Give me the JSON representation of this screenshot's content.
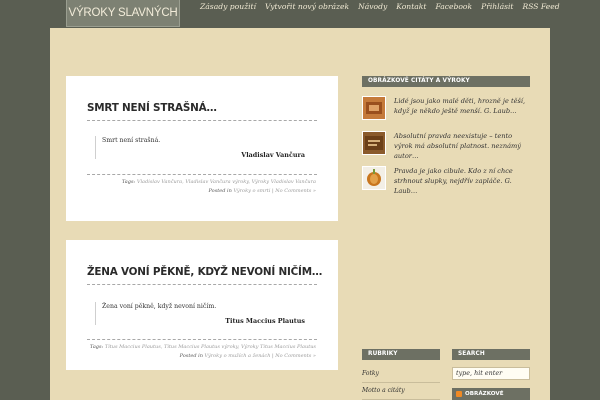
{
  "site": {
    "logo": "VÝROKY SLAVNÝCH"
  },
  "nav": [
    "Zásady použití",
    "Vytvořit nový obrázek",
    "Návody",
    "Kontakt",
    "Facebook",
    "Přihlásit",
    "RSS Feed"
  ],
  "posts": [
    {
      "title": "SMRT NENÍ STRAŠNÁ…",
      "quote": "Smrt není strašná.",
      "author": "Vladislav Vančura",
      "tags_label": "Tags:",
      "tags": "Vladislav Vančura, Vladislav Vančura výroky, Výroky Vladislav Vančura",
      "posted_label": "Posted in",
      "category": "Výroky o smrti",
      "comments": "No Comments »"
    },
    {
      "title": "ŽENA VONÍ PĚKNĚ, KDYŽ NEVONÍ NIČÍM…",
      "quote": "Žena voní pěkně, když nevoní ničím.",
      "author": "Titus Maccius Plautus",
      "tags_label": "Tags:",
      "tags": "Titus Maccius Plautus, Titus Maccius Plautus výroky, Výroky Titus Maccius Plautus",
      "posted_label": "Posted in",
      "category": "Výroky o mužích a ženách",
      "comments": "No Comments »"
    }
  ],
  "sidebar": {
    "featured_title": "OBRÁZKOVÉ CITÁTY A VÝROKY",
    "featured": [
      "Lidé jsou jako malé děti, hrozně je těší, když je někdo ještě menší. G. Laub…",
      "Absolutní pravda neexistuje – tento výrok má absolutní platnost. neznámý autor…",
      "Pravda je jako cibule. Kdo z ní chce strhnout slupky, nejdřív zapláče. G. Laub…"
    ],
    "categories_title": "RUBRIKY",
    "categories": [
      "Fotky",
      "Motto a citáty"
    ],
    "search_title": "SEARCH",
    "search_value": "type, hit enter",
    "rss_label": "OBRÁZKOVÉ"
  },
  "colors": {
    "background": "#5a5e52",
    "page": "#e8dbb6",
    "widget_header": "#6d7063",
    "rss": "#f08a24"
  }
}
